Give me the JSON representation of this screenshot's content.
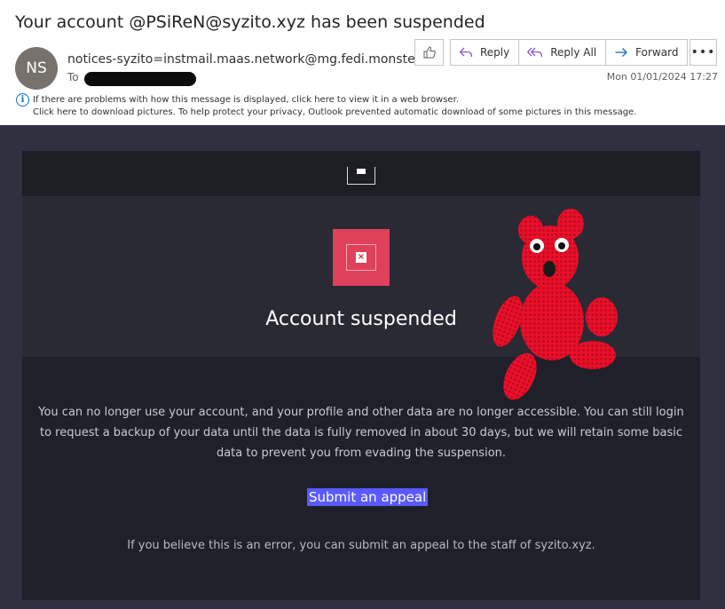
{
  "email": {
    "subject": "Your account @PSiReN@syzito.xyz has been suspended",
    "avatar_initials": "NS",
    "sender": "notices-syzito=instmail.maas.network@mg.fedi.monster",
    "to_label": "To",
    "date": "Mon 01/01/2024 17:27",
    "info_line1": "If there are problems with how this message is displayed, click here to view it in a web browser.",
    "info_line2": "Click here to download pictures. To help protect your privacy, Outlook prevented automatic download of some pictures in this message."
  },
  "actions": {
    "reply": "Reply",
    "reply_all": "Reply All",
    "forward": "Forward",
    "more": "•••"
  },
  "message": {
    "headline": "Account suspended",
    "paragraph": "You can no longer use your account, and your profile and other data are no longer accessible. You can still login to request a backup of your data until the data is fully removed in about 30 days, but we will retain some basic data to prevent you from evading the suspension.",
    "appeal_link": "Submit an appeal",
    "footer": "If you believe this is an error, you can submit an appeal to the staff of syzito.xyz."
  },
  "colors": {
    "body_background": "#2f3040",
    "icon_box": "#df405a",
    "link_highlight": "#595aff",
    "bear": "#e8102a"
  }
}
